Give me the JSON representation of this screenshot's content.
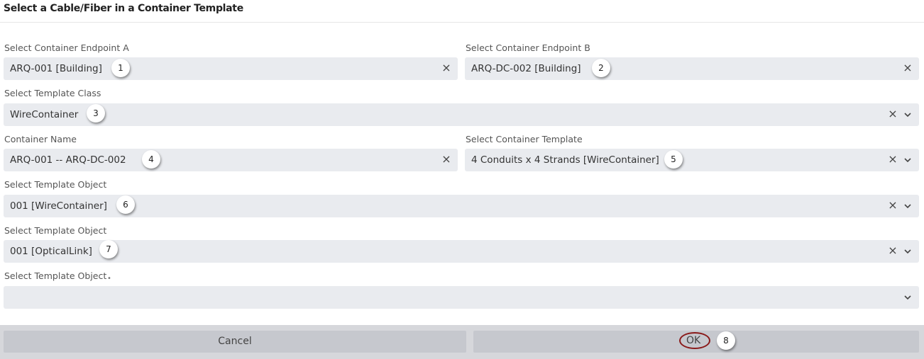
{
  "dialog": {
    "title": "Select a Cable/Fiber in a Container Template"
  },
  "fields": {
    "endpoint_a": {
      "label": "Select Container Endpoint A",
      "value": "ARQ-001 [Building]",
      "badge": "1"
    },
    "endpoint_b": {
      "label": "Select Container Endpoint B",
      "value": "ARQ-DC-002 [Building]",
      "badge": "2"
    },
    "template_class": {
      "label": "Select Template Class",
      "value": "WireContainer",
      "badge": "3"
    },
    "container_name": {
      "label": "Container Name",
      "value": "ARQ-001 -- ARQ-DC-002",
      "badge": "4"
    },
    "container_template": {
      "label": "Select Container Template",
      "value": "4 Conduits x 4 Strands [WireContainer]",
      "badge": "5"
    },
    "template_object_1": {
      "label": "Select Template Object",
      "value": "001 [WireContainer]",
      "badge": "6"
    },
    "template_object_2": {
      "label": "Select Template Object",
      "value": "001 [OpticalLink]",
      "badge": "7"
    },
    "template_object_3": {
      "label": "Select Template Object",
      "required_mark": "•",
      "value": ""
    }
  },
  "footer": {
    "cancel_label": "Cancel",
    "ok_label": "OK",
    "ok_badge": "8"
  },
  "icons": {
    "clear": "close-icon",
    "dropdown": "chevron-down-icon"
  },
  "colors": {
    "field_bg": "#e9ebef",
    "footer_bg": "#d6d7db",
    "button_bg": "#c6c8ce",
    "highlight": "#8a1a1a"
  }
}
